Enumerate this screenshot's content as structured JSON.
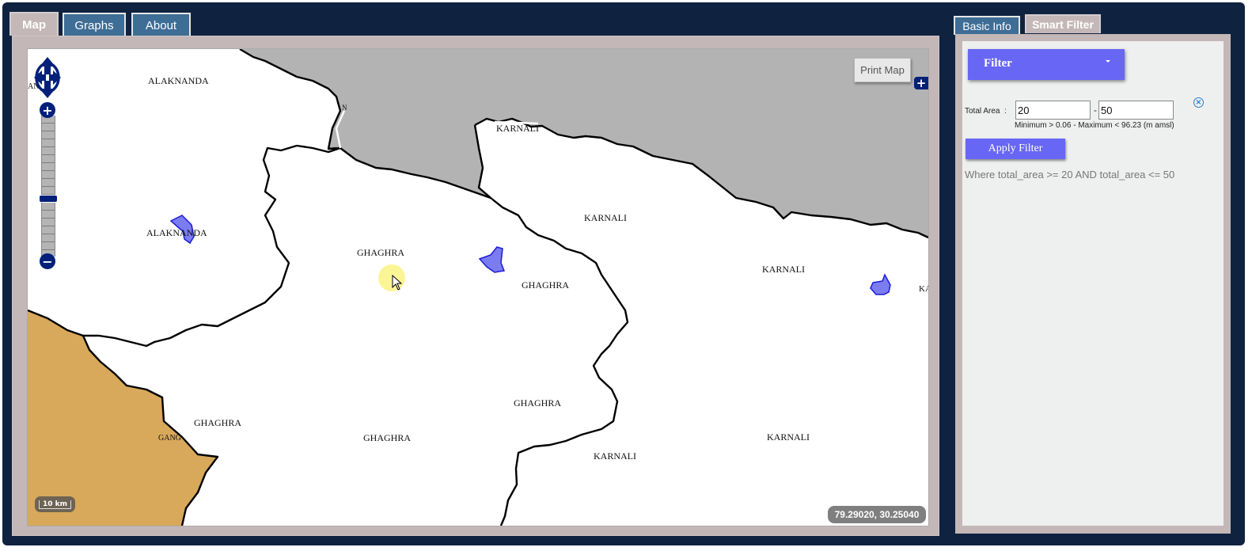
{
  "tabs": [
    {
      "label": "Map",
      "active": true
    },
    {
      "label": "Graphs",
      "active": false
    },
    {
      "label": "About",
      "active": false
    }
  ],
  "right_tabs": [
    {
      "label": "Basic Info",
      "active": false
    },
    {
      "label": "Smart Filter",
      "active": true
    }
  ],
  "map": {
    "print_label": "Print Map",
    "coordinates": "79.29020, 30.25040",
    "scale": "10 km",
    "zoom_icon": "pan-arrows-icon",
    "labels": [
      "ALAKNANDA",
      "ALAKNANDA",
      "KARNALI",
      "KARNALI",
      "KARNALI",
      "KARNALI",
      "KARNALI",
      "GHAGHRA",
      "GHAGHRA",
      "GHAGHRA",
      "GHAGHRA",
      "GHAGHRA",
      "AN",
      "GANG",
      "KA",
      "N"
    ],
    "colors": {
      "land_grey": "#b3b3b3",
      "land_orange": "#d8a95b",
      "lake_fill": "#7b7cf0",
      "lake_stroke": "#1c1cd8"
    }
  },
  "filter": {
    "dropdown_label": "Filter",
    "field_label": "Total Area",
    "colon": ":",
    "min_value": "20",
    "max_value": "50",
    "separator": "-",
    "hint": "Minimum > 0.06 - Maximum < 96.23 (m amsl)",
    "apply_label": "Apply Filter",
    "clear_icon": "clear-circle-icon",
    "where_clause": "Where total_area >= 20 AND total_area <= 50"
  }
}
